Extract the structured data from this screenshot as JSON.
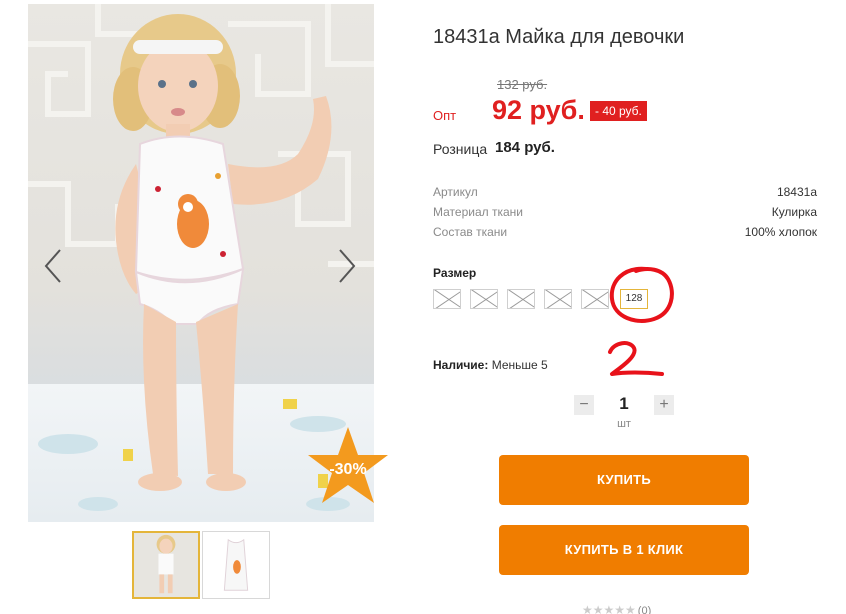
{
  "product": {
    "title": "18431а Майка для девочки",
    "old_price": "132 руб.",
    "opt_label": "Опт",
    "new_price": "92 руб.",
    "save_badge": "- 40 руб.",
    "retail_label": "Розница",
    "retail_price": "184 руб."
  },
  "gallery": {
    "discount_badge": "-30%",
    "prev_icon": "chevron-left-icon",
    "next_icon": "chevron-right-icon"
  },
  "properties": [
    {
      "name": "Артикул",
      "value": "18431а"
    },
    {
      "name": "Материал ткани",
      "value": "Кулирка"
    },
    {
      "name": "Состав ткани",
      "value": "100% хлопок"
    }
  ],
  "sizes": {
    "label": "Размер",
    "options": [
      {
        "label": "",
        "available": false
      },
      {
        "label": "",
        "available": false
      },
      {
        "label": "",
        "available": false
      },
      {
        "label": "",
        "available": false
      },
      {
        "label": "",
        "available": false
      },
      {
        "label": "128",
        "available": true,
        "selected": true
      }
    ]
  },
  "annotations": {
    "number": "2",
    "color": "#e8121a"
  },
  "stock": {
    "label": "Наличие:",
    "value": "Меньше 5"
  },
  "quantity": {
    "minus": "−",
    "value": "1",
    "plus": "+",
    "unit": "шт"
  },
  "buttons": {
    "buy": "КУПИТЬ",
    "buy_one_click": "КУПИТЬ В 1 КЛИК"
  },
  "rating": {
    "stars": "★★★★★",
    "count": "(0)"
  },
  "colors": {
    "accent": "#f07d00",
    "price": "#e02020",
    "selected_border": "#e4b53a"
  }
}
